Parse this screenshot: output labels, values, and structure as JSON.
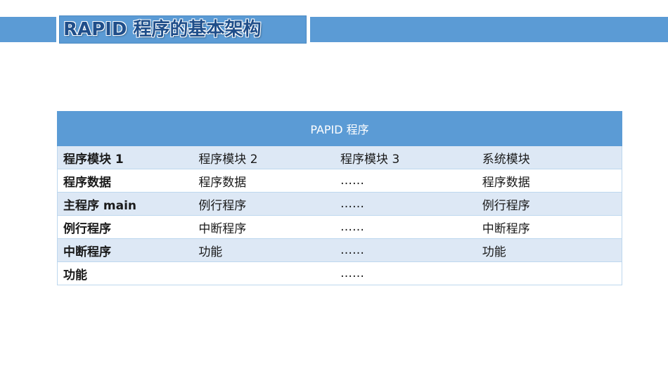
{
  "title": "RAPID 程序的基本架构",
  "table": {
    "header": "PAPID 程序",
    "rows": [
      [
        "程序模块 1",
        "程序模块 2",
        "程序模块 3",
        "系统模块"
      ],
      [
        "程序数据",
        "程序数据",
        "……",
        "程序数据"
      ],
      [
        "主程序 main",
        "例行程序",
        "……",
        "例行程序"
      ],
      [
        "例行程序",
        "中断程序",
        "……",
        "中断程序"
      ],
      [
        "中断程序",
        "功能",
        "……",
        "功能"
      ],
      [
        "功能",
        "",
        "……",
        ""
      ]
    ]
  },
  "colors": {
    "accent": "#5b9bd5",
    "title_text": "#1f4e8a",
    "row_band": "#dde8f5"
  }
}
